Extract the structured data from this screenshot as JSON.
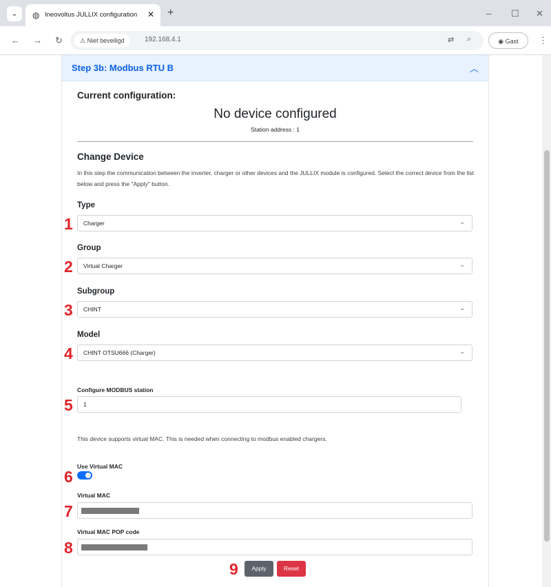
{
  "browser": {
    "tab_title": "Ineovoltus JULLIX configuration",
    "tab_close": "✕",
    "security_label": "Niet beveiligd",
    "url": "192.168.4.1",
    "profile_label": "Gast"
  },
  "panel": {
    "title": "Step 3b: Modbus RTU B",
    "current_heading": "Current configuration:",
    "device_status": "No device configured",
    "station_address": "Station address : 1",
    "change_heading": "Change Device",
    "description": "In this step the communication between the inverter, charger or other devices and the JULLIX module is configured. Select the correct device from the list below and press the \"Apply\" button."
  },
  "form": {
    "type_label": "Type",
    "type_value": "Charger",
    "group_label": "Group",
    "group_value": "Virtual Charger",
    "subgroup_label": "Subgroup",
    "subgroup_value": "CHINT",
    "model_label": "Model",
    "model_value": "CHINT OTSU666 (Charger)",
    "modbus_label": "Configure MODBUS station",
    "modbus_value": "1",
    "virtual_mac_note": "This device supports virtual MAC. This is needed when connecting to modbus enabled chargers.",
    "use_virtual_mac_label": "Use Virtual MAC",
    "use_virtual_mac_on": true,
    "virtual_mac_label": "Virtual MAC",
    "virtual_mac_pop_label": "Virtual MAC POP code",
    "apply_label": "Apply",
    "reset_label": "Reset"
  },
  "markers": [
    "1",
    "2",
    "3",
    "4",
    "5",
    "6",
    "7",
    "8",
    "9"
  ],
  "colors": {
    "accent": "#0d6efd",
    "header_bg": "#e7f1ff",
    "header_text": "#0c63e4",
    "marker_red": "#e0242b",
    "apply_bg": "#5c636a",
    "reset_bg": "#dc3545"
  }
}
